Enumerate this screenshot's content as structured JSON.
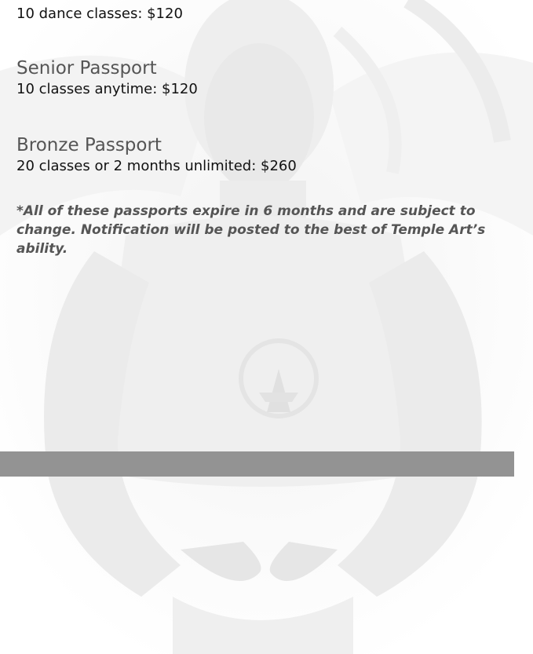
{
  "intro_line": "10 dance classes: $120",
  "passports": [
    {
      "title": "Senior Passport",
      "desc": "10 classes anytime: $120"
    },
    {
      "title": "Bronze Passport",
      "desc": "20 classes or 2 months unlimited: $260"
    }
  ],
  "note": "*All of these passports expire in 6 months and are subject to change. Notification will be posted to the best of Temple Art’s ability.",
  "colors": {
    "bar": "#939393",
    "title_text": "#555555",
    "body_text": "#111111"
  }
}
